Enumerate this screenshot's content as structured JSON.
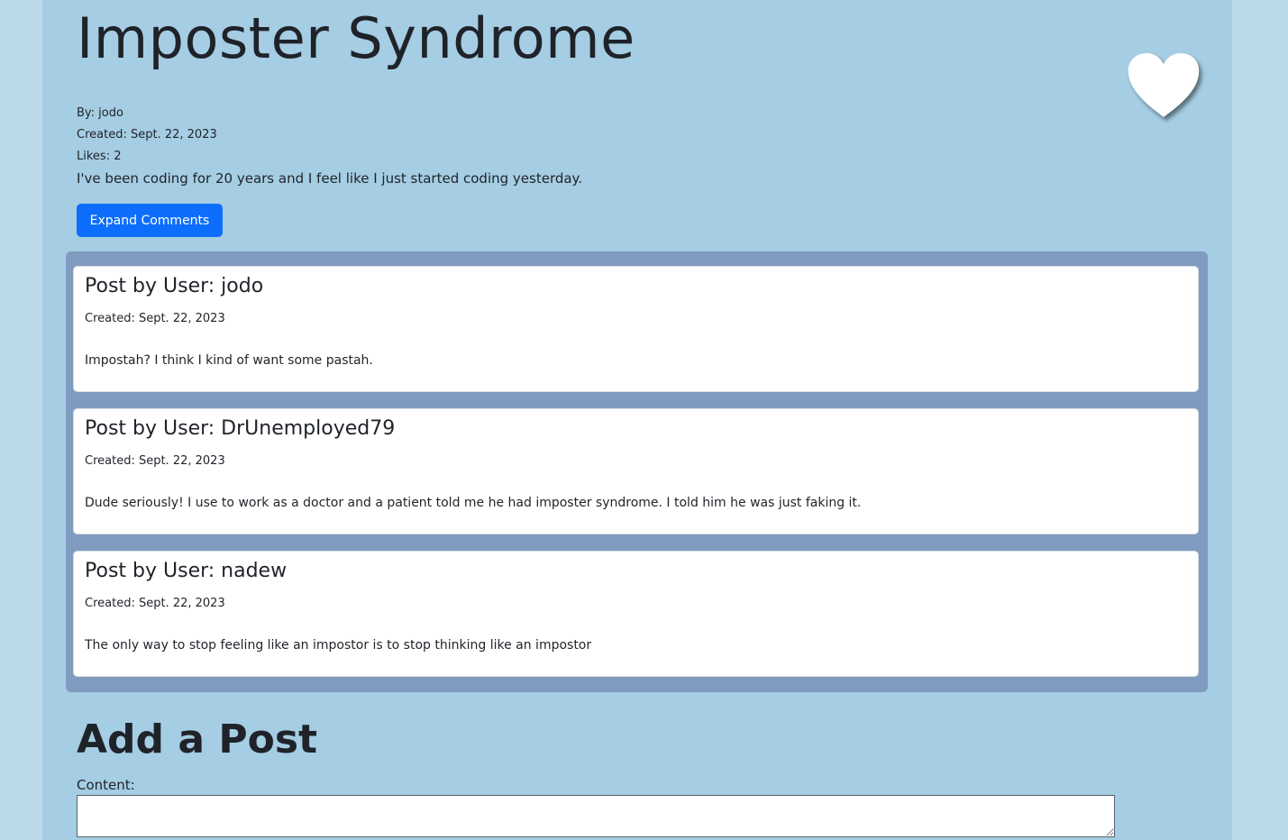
{
  "post": {
    "title": "Imposter Syndrome",
    "by": "By: jodo",
    "created": "Created: Sept. 22, 2023",
    "likes": "Likes: 2",
    "body": "I've been coding for 20 years and I feel like I just started coding yesterday.",
    "like_icon": "heart-icon",
    "like_color": "#ffffff"
  },
  "expand_button": {
    "label": "Expand Comments",
    "color": "#0d6efd"
  },
  "comments": [
    {
      "title": "Post by User: jodo",
      "created": "Created: Sept. 22, 2023",
      "text": "Impostah? I think I kind of want some pastah."
    },
    {
      "title": "Post by User: DrUnemployed79",
      "created": "Created: Sept. 22, 2023",
      "text": "Dude seriously! I use to work as a doctor and a patient told me he had imposter syndrome. I told him he was just faking it."
    },
    {
      "title": "Post by User: nadew",
      "created": "Created: Sept. 22, 2023",
      "text": "The only way to stop feeling like an impostor is to stop thinking like an impostor"
    }
  ],
  "add_post": {
    "heading": "Add a Post",
    "content_label": "Content:",
    "content_value": ""
  },
  "colors": {
    "outer_background": "#bcd9ea",
    "page_background": "#a5cde3",
    "comments_panel": "#7f9bbf"
  }
}
